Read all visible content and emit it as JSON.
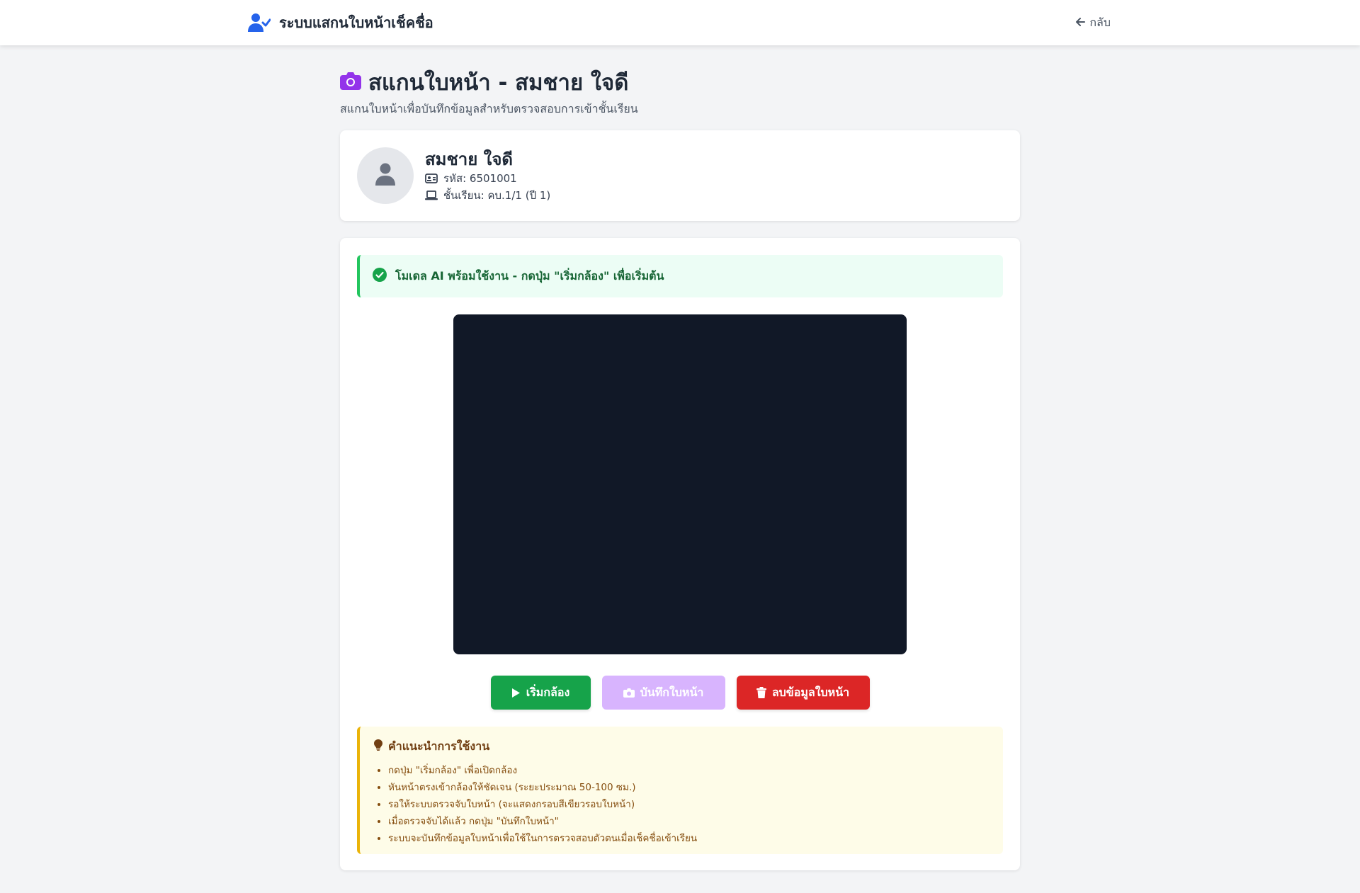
{
  "nav": {
    "brand_icon": "user-check-icon",
    "title": "ระบบแสกนใบหน้าเช็คชื่อ",
    "back_icon": "arrow-left-icon",
    "back_label": "กลับ"
  },
  "page": {
    "title_icon": "camera-icon",
    "title": "สแกนใบหน้า - สมชาย ใจดี",
    "subtitle": "สแกนใบหน้าเพื่อบันทึกข้อมูลสำหรับตรวจสอบการเข้าชั้นเรียน"
  },
  "student": {
    "avatar_icon": "user-icon",
    "name": "สมชาย ใจดี",
    "id_icon": "id-card-icon",
    "id_text": "รหัส: 6501001",
    "class_icon": "laptop-icon",
    "class_text": "ชั้นเรียน: คบ.1/1 (ปี 1)"
  },
  "alert": {
    "icon": "check-circle-icon",
    "text": "โมเดล AI พร้อมใช้งาน - กดปุ่ม \"เริ่มกล้อง\" เพื่อเริ่มต้น"
  },
  "buttons": {
    "start_icon": "play-icon",
    "start_label": "เริ่มกล้อง",
    "capture_icon": "camera-icon",
    "capture_label": "บันทึกใบหน้า",
    "delete_icon": "trash-icon",
    "delete_label": "ลบข้อมูลใบหน้า"
  },
  "tips": {
    "icon": "lightbulb-icon",
    "title": "คำแนะนำการใช้งาน",
    "items": [
      "กดปุ่ม \"เริ่มกล้อง\" เพื่อเปิดกล้อง",
      "หันหน้าตรงเข้ากล้องให้ชัดเจน (ระยะประมาณ 50-100 ซม.)",
      "รอให้ระบบตรวจจับใบหน้า (จะแสดงกรอบสีเขียวรอบใบหน้า)",
      "เมื่อตรวจจับได้แล้ว กดปุ่ม \"บันทึกใบหน้า\"",
      "ระบบจะบันทึกข้อมูลใบหน้าเพื่อใช้ในการตรวจสอบตัวตนเมื่อเช็คชื่อเข้าเรียน"
    ]
  },
  "colors": {
    "primary": "#2563eb",
    "accent_purple": "#9333ea",
    "success": "#16a34a",
    "danger": "#dc2626",
    "warning": "#eab308",
    "video_bg": "#111827"
  }
}
